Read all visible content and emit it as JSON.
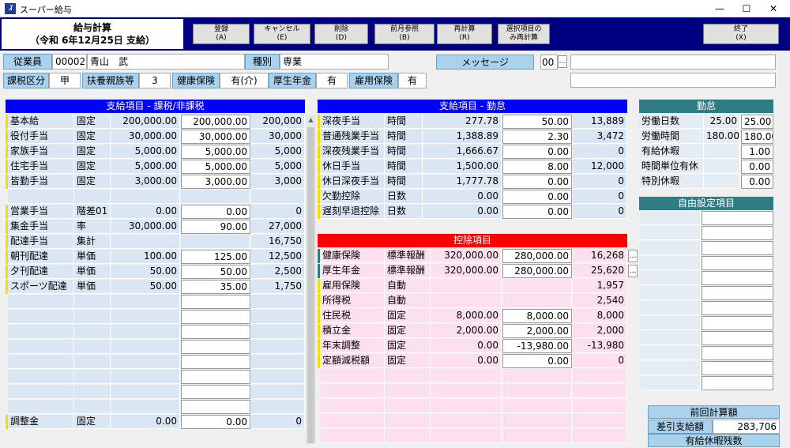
{
  "window": {
    "title": "スーパー給与",
    "icon": "app-logo-icon"
  },
  "header": {
    "title": "給与計算",
    "subtitle": "（令和 6年12月25日  支給）"
  },
  "toolbar": [
    {
      "id": "register",
      "line1": "登録",
      "line2": "(A)"
    },
    {
      "id": "cancel",
      "line1": "キャンセル",
      "line2": "(E)"
    },
    {
      "id": "delete",
      "line1": "削除",
      "line2": "(D)"
    },
    {
      "id": "prevmonth",
      "line1": "前月参照",
      "line2": "(B)"
    },
    {
      "id": "recalc",
      "line1": "再計算",
      "line2": "(R)"
    },
    {
      "id": "selrecalc",
      "line1": "選択項目の",
      "line2": "み再計算"
    },
    {
      "id": "exit",
      "line1": "終了",
      "line2": "(X)"
    }
  ],
  "employee": {
    "label": "従業員",
    "code": "00002",
    "name": "青山　武",
    "type_label": "種別",
    "type": "専業"
  },
  "message": {
    "label": "メッセージ",
    "code": "00",
    "text": "",
    "text2": ""
  },
  "tax": {
    "class_label": "課税区分",
    "class": "甲",
    "dep_label": "扶養親族等",
    "dep": "3",
    "health_label": "健康保険",
    "health": "有(介)",
    "pension_label": "厚生年金",
    "pension": "有",
    "emp_label": "雇用保険",
    "emp": "有"
  },
  "payments": {
    "title": "支給項目 - 課税/非課税",
    "rows": [
      [
        "基本給",
        "固定",
        "200,000.00",
        "200,000.00",
        "200,000"
      ],
      [
        "役付手当",
        "固定",
        "30,000.00",
        "30,000.00",
        "30,000"
      ],
      [
        "家族手当",
        "固定",
        "5,000.00",
        "5,000.00",
        "5,000"
      ],
      [
        "住宅手当",
        "固定",
        "5,000.00",
        "5,000.00",
        "5,000"
      ],
      [
        "皆勤手当",
        "固定",
        "3,000.00",
        "3,000.00",
        "3,000"
      ],
      [
        "",
        "",
        "",
        "",
        ""
      ],
      [
        "営業手当",
        "階差01",
        "0.00",
        "0.00",
        "0"
      ],
      [
        "集金手当",
        "率",
        "30,000.00",
        "90.00",
        "27,000"
      ],
      [
        "配達手当",
        "集計",
        "",
        "",
        "16,750"
      ],
      [
        "朝刊配達",
        "単価",
        "100.00",
        "125.00",
        "12,500"
      ],
      [
        "夕刊配達",
        "単価",
        "50.00",
        "50.00",
        "2,500"
      ],
      [
        "スポーツ配達",
        "単価",
        "50.00",
        "35.00",
        "1,750"
      ]
    ],
    "adjust": [
      "調整金",
      "固定",
      "0.00",
      "0.00",
      "0"
    ]
  },
  "work": {
    "title": "支給項目 - 勤怠",
    "rows": [
      [
        "深夜手当",
        "時間",
        "277.78",
        "50.00",
        "13,889"
      ],
      [
        "普通残業手当",
        "時間",
        "1,388.89",
        "2.30",
        "3,472"
      ],
      [
        "深夜残業手当",
        "時間",
        "1,666.67",
        "0.00",
        "0"
      ],
      [
        "休日手当",
        "時間",
        "1,500.00",
        "8.00",
        "12,000"
      ],
      [
        "休日深夜手当",
        "時間",
        "1,777.78",
        "0.00",
        "0"
      ],
      [
        "欠勤控除",
        "日数",
        "0.00",
        "0.00",
        "0"
      ],
      [
        "遅刻早退控除",
        "日数",
        "0.00",
        "0.00",
        "0"
      ]
    ]
  },
  "deductions": {
    "title": "控除項目",
    "rows": [
      [
        "健康保険",
        "標準報酬",
        "320,000.00",
        "280,000.00",
        "16,268"
      ],
      [
        "厚生年金",
        "標準報酬",
        "320,000.00",
        "280,000.00",
        "25,620"
      ],
      [
        "雇用保険",
        "自動",
        "",
        "",
        "1,957"
      ],
      [
        "所得税",
        "自動",
        "",
        "",
        "2,540"
      ],
      [
        "住民税",
        "固定",
        "8,000.00",
        "8,000.00",
        "8,000"
      ],
      [
        "積立金",
        "固定",
        "2,000.00",
        "2,000.00",
        "2,000"
      ],
      [
        "年末調整",
        "固定",
        "0.00",
        "-13,980.00",
        "-13,980"
      ],
      [
        "定額減税額",
        "固定",
        "0.00",
        "0.00",
        "0"
      ]
    ]
  },
  "attendance": {
    "title": "勤怠",
    "rows": [
      [
        "労働日数",
        "25.00",
        "25.00"
      ],
      [
        "労働時間",
        "180.00",
        "180.00"
      ],
      [
        "有給休暇",
        "",
        "1.00"
      ],
      [
        "時間単位有休",
        "",
        "0.00"
      ],
      [
        "特別休暇",
        "",
        "0.00"
      ]
    ]
  },
  "free": {
    "title": "自由設定項目"
  },
  "prev": {
    "title": "前回計算額",
    "net_label": "差引支給額",
    "net": "283,706",
    "leave_label": "有給休暇残数"
  },
  "colors": {
    "navy": "#000080",
    "blue": "#0000ff",
    "red": "#ff0000",
    "teal": "#2f7d84"
  }
}
